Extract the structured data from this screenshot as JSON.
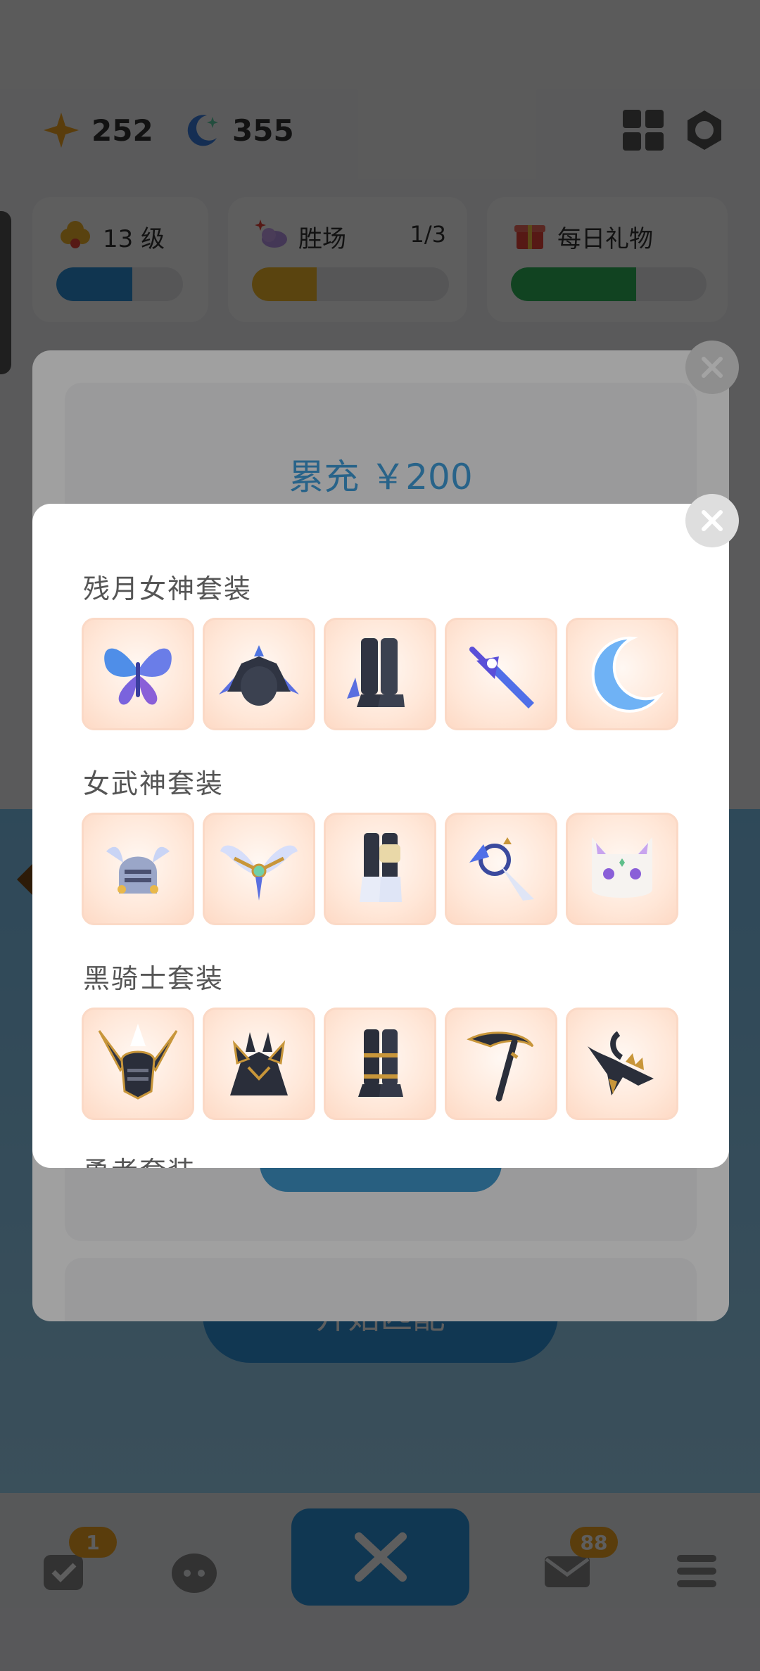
{
  "topbar": {
    "stars_value": "252",
    "moons_value": "355"
  },
  "cards": {
    "level": {
      "label": "13 级",
      "progress": 0.6,
      "color": "#2d8fd9"
    },
    "wins": {
      "label": "胜场",
      "count": "1/3",
      "progress": 0.33,
      "color": "#f4b82a"
    },
    "daily_gift": {
      "label": "每日礼物",
      "progress": 0.64,
      "color": "#2fb75a"
    }
  },
  "main": {
    "match_button_label": "开始匹配"
  },
  "bottom_nav": {
    "tasks_badge": "1",
    "mail_badge": "88"
  },
  "recharge_panel": {
    "title": "累充 ￥200"
  },
  "sets_panel": {
    "sets": [
      {
        "title": "残月女神套装",
        "items": [
          "butterfly-wings-icon",
          "dark-armor-icon",
          "dark-boots-icon",
          "blue-sword-icon",
          "crescent-moon-icon"
        ]
      },
      {
        "title": "女武神套装",
        "items": [
          "winged-helmet-icon",
          "angel-wings-icon",
          "white-boots-icon",
          "star-halo-icon",
          "white-cat-icon"
        ]
      },
      {
        "title": "黑骑士套装",
        "items": [
          "black-horned-helmet-icon",
          "black-gold-armor-icon",
          "black-boots-icon",
          "black-scythe-icon",
          "black-dragon-icon"
        ]
      },
      {
        "title": "勇者套装",
        "items": []
      }
    ]
  }
}
